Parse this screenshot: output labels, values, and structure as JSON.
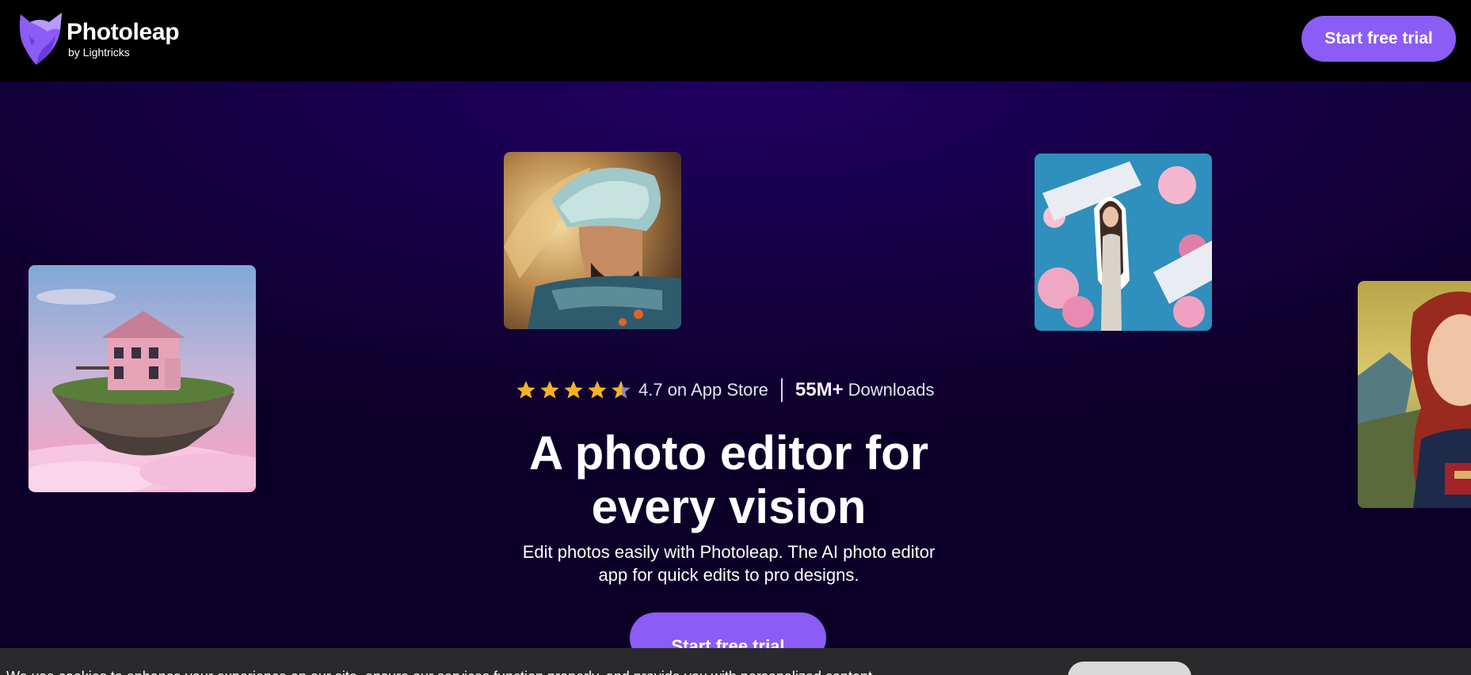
{
  "header": {
    "brand_name": "Photoleap",
    "brand_sub": "by Lightricks",
    "cta_label": "Start free trial"
  },
  "hero": {
    "rating_value": 4.7,
    "rating_text": "4.7 on App Store",
    "downloads_count": "55M+",
    "downloads_label": "Downloads",
    "headline_line1": "A photo editor for",
    "headline_line2": "every vision",
    "subhead_line1": "Edit photos easily with Photoleap. The AI photo editor",
    "subhead_line2": "app for quick edits to pro designs.",
    "cta_label": "Start free trial"
  },
  "gallery": [
    {
      "subject": "floating-house-image"
    },
    {
      "subject": "warrior-portrait-image"
    },
    {
      "subject": "floral-collage-image"
    },
    {
      "subject": "renaissance-portrait-image"
    }
  ],
  "cookie_bar": {
    "text": "We use cookies to enhance your experience on our site, ensure our services function properly, and provide you with personalized content."
  },
  "colors": {
    "accent": "#8b5cf6",
    "star": "#f5b324",
    "hero_bg": "#170048"
  }
}
